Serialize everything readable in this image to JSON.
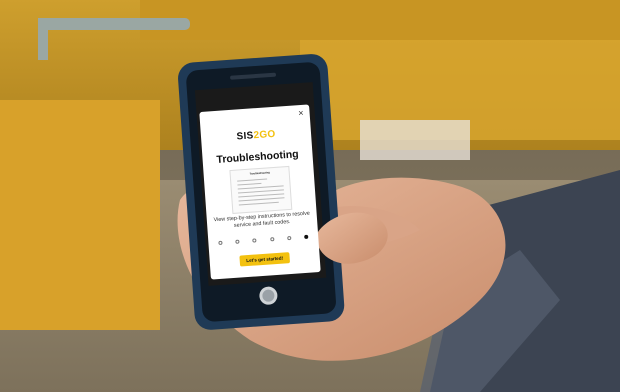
{
  "app": {
    "logo_text_sis": "SIS",
    "logo_text_go": "2GO",
    "close_label": "×"
  },
  "modal": {
    "title": "Troubleshooting",
    "thumbnail_title": "Troubleshooting",
    "description": "View step-by-step instructions to resolve service and fault codes.",
    "cta_label": "Let's get started!",
    "pager": {
      "total": 6,
      "active_index": 5
    }
  },
  "colors": {
    "brand_yellow": "#f3c10f",
    "modal_background": "#ffffff"
  }
}
